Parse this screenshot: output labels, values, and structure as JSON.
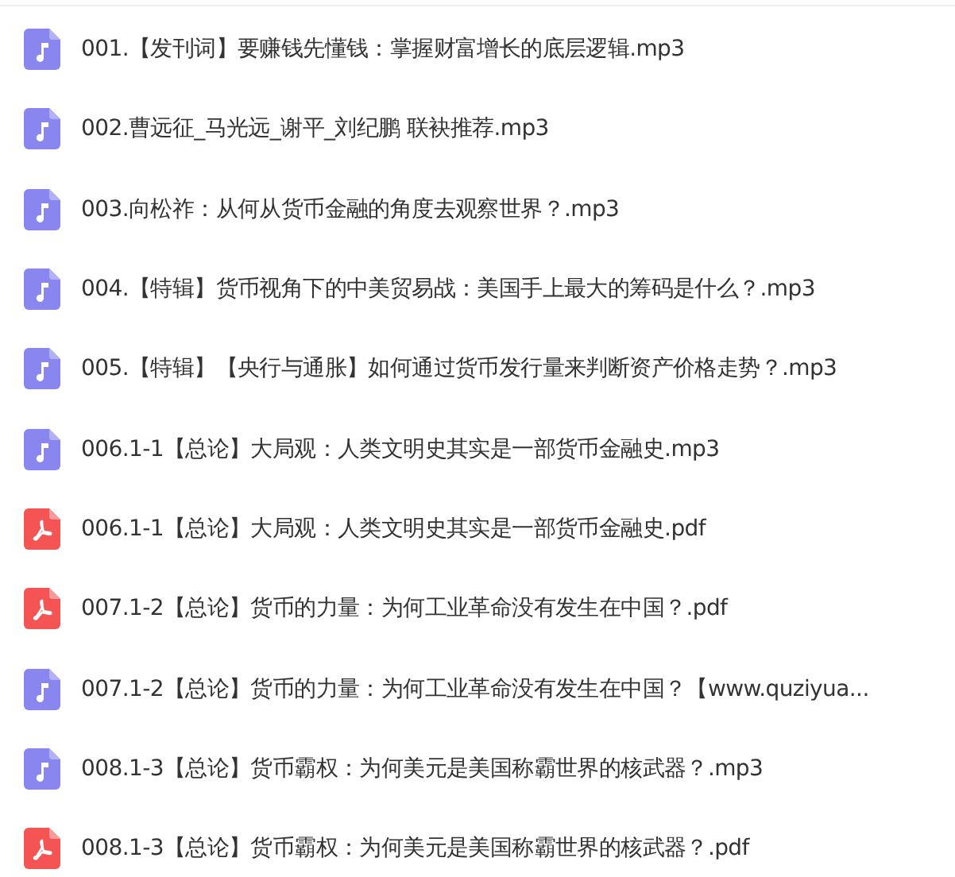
{
  "files": [
    {
      "kind": "audio",
      "name": "001.【发刊词】要赚钱先懂钱：掌握财富增长的底层逻辑.mp3"
    },
    {
      "kind": "audio",
      "name": "002.曹远征_马光远_谢平_刘纪鹏 联袂推荐.mp3"
    },
    {
      "kind": "audio",
      "name": "003.向松祚：从何从货币金融的角度去观察世界？.mp3"
    },
    {
      "kind": "audio",
      "name": "004.【特辑】货币视角下的中美贸易战：美国手上最大的筹码是什么？.mp3"
    },
    {
      "kind": "audio",
      "name": "005.【特辑】【央行与通胀】如何通过货币发行量来判断资产价格走势？.mp3"
    },
    {
      "kind": "audio",
      "name": "006.1-1【总论】大局观：人类文明史其实是一部货币金融史.mp3"
    },
    {
      "kind": "pdf",
      "name": "006.1-1【总论】大局观：人类文明史其实是一部货币金融史.pdf"
    },
    {
      "kind": "pdf",
      "name": "007.1-2【总论】货币的力量：为何工业革命没有发生在中国？.pdf"
    },
    {
      "kind": "audio",
      "name": "007.1-2【总论】货币的力量：为何工业革命没有发生在中国？【www.quziyua..."
    },
    {
      "kind": "audio",
      "name": "008.1-3【总论】货币霸权：为何美元是美国称霸世界的核武器？.mp3"
    },
    {
      "kind": "pdf",
      "name": "008.1-3【总论】货币霸权：为何美元是美国称霸世界的核武器？.pdf"
    }
  ]
}
